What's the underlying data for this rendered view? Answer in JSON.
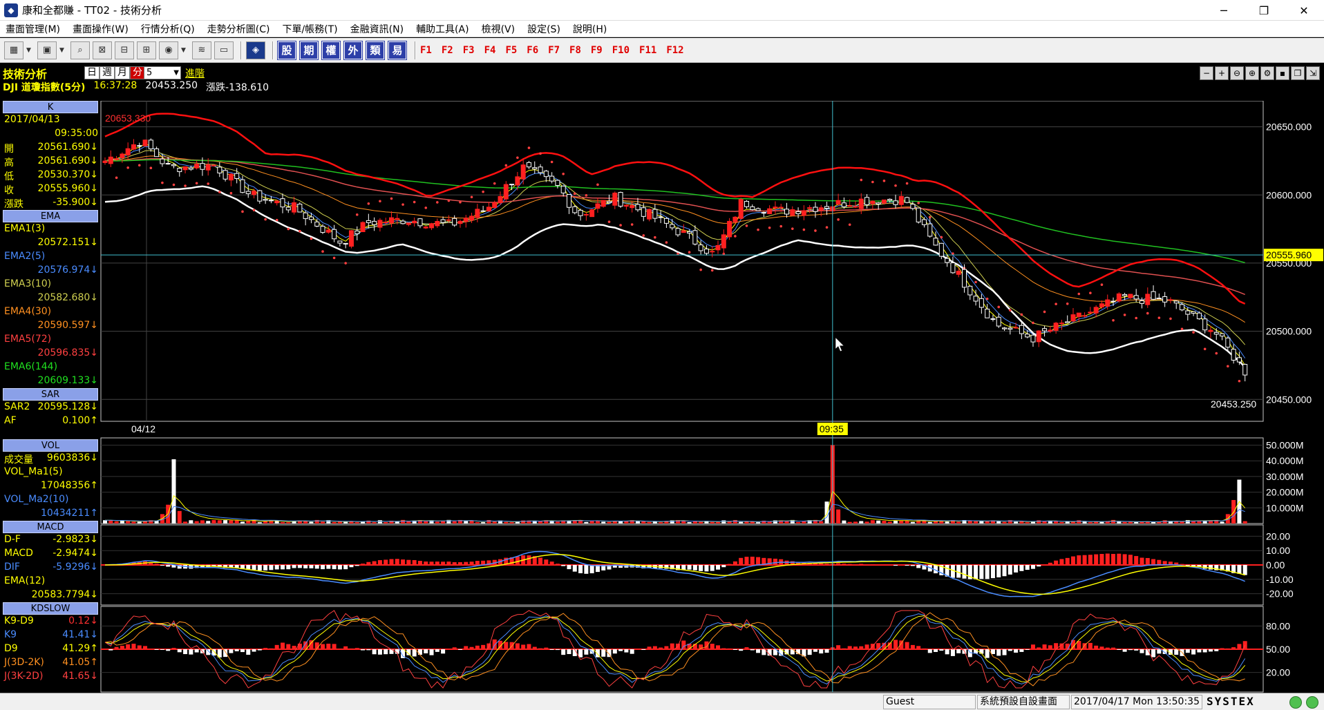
{
  "window": {
    "title": "康和全都賺 - TT02 - 技術分析",
    "minimize": "─",
    "maximize": "❐",
    "close": "✕"
  },
  "menu": [
    "畫面管理(M)",
    "畫面操作(W)",
    "行情分析(Q)",
    "走勢分析圖(C)",
    "下單/帳務(T)",
    "金融資訊(N)",
    "輔助工具(A)",
    "檢視(V)",
    "設定(S)",
    "說明(H)"
  ],
  "toolbar": {
    "quick_buttons": [
      "股",
      "期",
      "權",
      "外",
      "類",
      "易"
    ],
    "fkeys": [
      "F1",
      "F2",
      "F3",
      "F4",
      "F5",
      "F6",
      "F7",
      "F8",
      "F9",
      "F10",
      "F11",
      "F12"
    ]
  },
  "header": {
    "section_title": "技術分析",
    "periods": [
      "日",
      "週",
      "月",
      "分"
    ],
    "active_period": "分",
    "interval": "5",
    "advanced": "進階",
    "symbol": "DJI  道瓊指數(5分)",
    "time": "16:37:28",
    "price": "20453.250",
    "change": "漲跌-138.610"
  },
  "panel": {
    "k": {
      "head": "K",
      "date": "2017/04/13",
      "time": "09:35:00",
      "rows": [
        {
          "label": "開",
          "value": "20561.690↓",
          "color": "#ffff00"
        },
        {
          "label": "高",
          "value": "20561.690↓",
          "color": "#ffff00"
        },
        {
          "label": "低",
          "value": "20530.370↓",
          "color": "#ffff00"
        },
        {
          "label": "收",
          "value": "20555.960↓",
          "color": "#ffff00"
        },
        {
          "label": "漲跌",
          "value": "-35.900↓",
          "color": "#ffff00"
        }
      ]
    },
    "ema": {
      "head": "EMA",
      "rows": [
        {
          "label": "EMA1(3)",
          "value": "20572.151↓",
          "color": "#ffff00"
        },
        {
          "label": "EMA2(5)",
          "value": "20576.974↓",
          "color": "#4a8cff"
        },
        {
          "label": "EMA3(10)",
          "value": "20582.680↓",
          "color": "#d0d050"
        },
        {
          "label": "EMA4(30)",
          "value": "20590.597↓",
          "color": "#ff9020"
        },
        {
          "label": "EMA5(72)",
          "value": "20596.835↓",
          "color": "#ff4040"
        },
        {
          "label": "EMA6(144)",
          "value": "20609.133↓",
          "color": "#20e020"
        }
      ]
    },
    "sar": {
      "head": "SAR",
      "rows": [
        {
          "label": "SAR2",
          "value": "20595.128↓",
          "color": "#ffff00"
        },
        {
          "label": "AF",
          "value": "0.100↑",
          "color": "#ffff00"
        }
      ]
    },
    "vol": {
      "head": "VOL",
      "rows": [
        {
          "label": "成交量",
          "value": "9603836↓",
          "color": "#ffff00"
        },
        {
          "label": "VOL_Ma1(5)",
          "value": "",
          "color": "#ffff00"
        },
        {
          "label": "",
          "value": "17048356↑",
          "color": "#ffff00"
        },
        {
          "label": "VOL_Ma2(10)",
          "value": "",
          "color": "#4a8cff"
        },
        {
          "label": "",
          "value": "10434211↑",
          "color": "#4a8cff"
        }
      ]
    },
    "macd": {
      "head": "MACD",
      "rows": [
        {
          "label": "D-F",
          "value": "-2.9823↓",
          "color": "#ffff00"
        },
        {
          "label": "MACD",
          "value": "-2.9474↓",
          "color": "#ffff00"
        },
        {
          "label": "DIF",
          "value": "-5.9296↓",
          "color": "#4a8cff"
        },
        {
          "label": "EMA(12)",
          "value": "",
          "color": "#ffff00"
        },
        {
          "label": "",
          "value": "20583.7794↓",
          "color": "#ffff00"
        }
      ]
    },
    "kd": {
      "head": "KDSLOW",
      "rows": [
        {
          "label": "K9-D9",
          "value": "0.12↓",
          "color": "#ffff00",
          "valcolor": "#ff3030"
        },
        {
          "label": "K9",
          "value": "41.41↓",
          "color": "#4a8cff"
        },
        {
          "label": "D9",
          "value": "41.29↑",
          "color": "#ffff00"
        },
        {
          "label": "J(3D-2K)",
          "value": "41.05↑",
          "color": "#ff9020"
        },
        {
          "label": "J(3K-2D)",
          "value": "41.65↓",
          "color": "#ff4040"
        }
      ]
    }
  },
  "chart_data": {
    "type": "candlestick",
    "main_axis": {
      "ticks": [
        "20650.000",
        "20600.000",
        "20550.000",
        "20500.000",
        "20450.000"
      ],
      "ylim": [
        20440,
        20665
      ]
    },
    "hi_label": "20653.330",
    "last_label": "20555.960",
    "close_label": "20453.250",
    "date_label": "04/12",
    "cursor_time": "09:35",
    "vol_axis": {
      "ticks": [
        "50.000M",
        "40.000M",
        "30.000M",
        "20.000M",
        "10.000M"
      ]
    },
    "macd_axis": {
      "ticks": [
        "20.00",
        "10.00",
        "0.00",
        "-10.00",
        "-20.00"
      ]
    },
    "kd_axis": {
      "ticks": [
        "80.00",
        "50.00",
        "20.00"
      ]
    },
    "colors": {
      "up": "#ff2020",
      "down": "#ffffff",
      "bb_upper": "#ff1010",
      "bb_lower": "#ffffff",
      "ema144": "#20c020",
      "ema72": "#e05050",
      "sar": "#ff4040"
    }
  },
  "status": {
    "user": "Guest",
    "layout": "系統預設自設畫面",
    "datetime": "2017/04/17 Mon 13:50:35",
    "brand": "SYSTEX"
  }
}
